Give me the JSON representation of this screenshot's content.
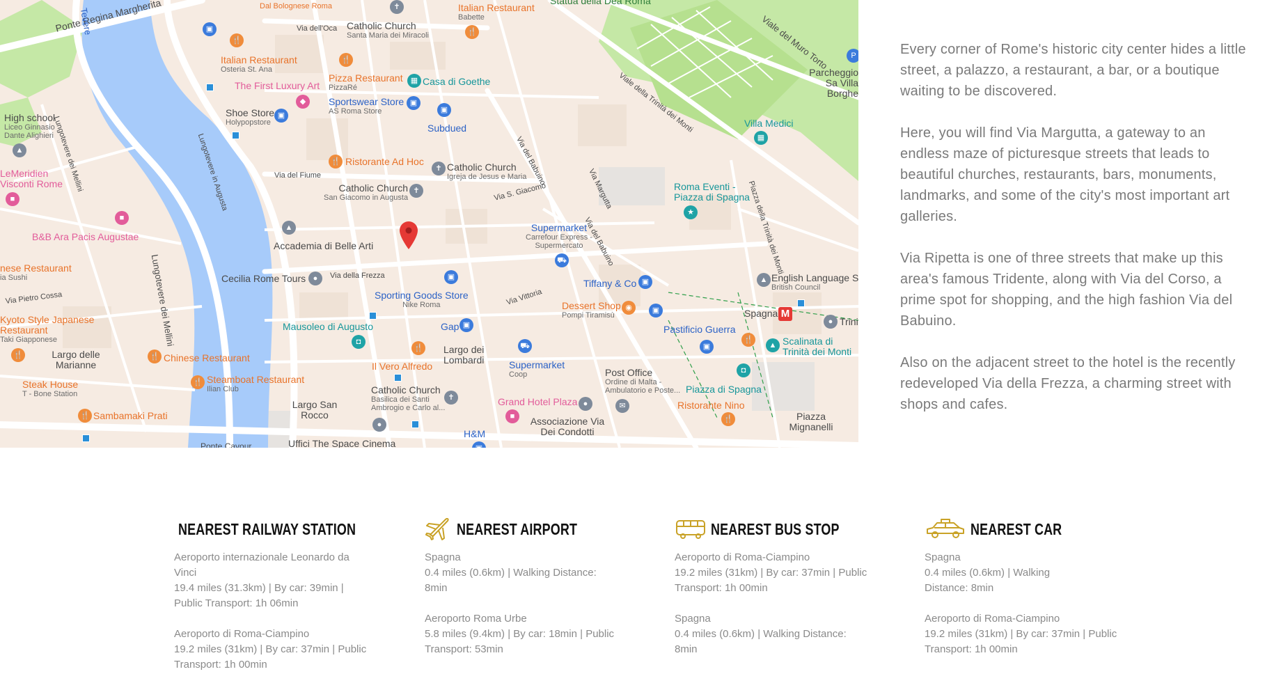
{
  "map": {
    "accent_colors": {
      "water": "#a7cbfa",
      "park": "#c5e8a6",
      "land": "#f6ebe2",
      "street": "#ffffff",
      "marker": "#e53935"
    },
    "streets": [
      "Ponte Regina Margherita",
      "Via dell'Oca",
      "Lungotevere dei Mellini",
      "Lungotevere in Augusta",
      "Lungotevere dei Mellini",
      "Via del Fiume",
      "Via S. Giacomo",
      "Via della Frezza",
      "Via Pietro Cossa",
      "Via del Babuino",
      "Via Margutta",
      "Via del Babuino",
      "Via Vittoria",
      "Viale della Trinità dei Monti",
      "Viale del Muro Torto",
      "Piazza della Trinità dei Monti",
      "Ponte Cavour",
      "Tevere"
    ],
    "pois": [
      {
        "name": "Dal Bolognese Roma",
        "sub": ""
      },
      {
        "name": "Catholic Church",
        "sub": "Santa Maria dei Miracoli"
      },
      {
        "name": "Italian Restaurant",
        "sub": "Babette"
      },
      {
        "name": "Statua della Dea Roma",
        "sub": ""
      },
      {
        "name": "Italian Restaurant",
        "sub": "Osteria St. Ana"
      },
      {
        "name": "Pizza Restaurant",
        "sub": "PizzaRé"
      },
      {
        "name": "Casa di Goethe",
        "sub": ""
      },
      {
        "name": "The First Luxury Art",
        "sub": ""
      },
      {
        "name": "Sportswear Store",
        "sub": "AS Roma Store"
      },
      {
        "name": "High school",
        "sub": "Liceo Ginnasio Dante Alighieri"
      },
      {
        "name": "Shoe Store",
        "sub": "Holypopstore"
      },
      {
        "name": "Subdued",
        "sub": ""
      },
      {
        "name": "Ristorante Ad Hoc",
        "sub": ""
      },
      {
        "name": "Catholic Church",
        "sub": "Igreja de Jesus e Maria"
      },
      {
        "name": "LeMeridien Visconti Rome",
        "sub": ""
      },
      {
        "name": "Catholic Church",
        "sub": "San Giacomo in Augusta"
      },
      {
        "name": "B&B Ara Pacis Augustae",
        "sub": ""
      },
      {
        "name": "Accademia di Belle Arti",
        "sub": ""
      },
      {
        "name": "Supermarket",
        "sub": "Carrefour Express - Supermercato"
      },
      {
        "name": "Roma Eventi - Piazza di Spagna",
        "sub": ""
      },
      {
        "name": "Parcheggio Sa Villa Borghe",
        "sub": ""
      },
      {
        "name": "Villa Medici",
        "sub": ""
      },
      {
        "name": "nese Restaurant",
        "sub": "ia Sushi"
      },
      {
        "name": "Cecilia Rome Tours",
        "sub": ""
      },
      {
        "name": "Sporting Goods Store",
        "sub": "Nike Roma"
      },
      {
        "name": "Tiffany & Co",
        "sub": ""
      },
      {
        "name": "English Language Sc",
        "sub": "British Council"
      },
      {
        "name": "Dessert Shop",
        "sub": "Pompi Tiramisù"
      },
      {
        "name": "Spagna",
        "sub": ""
      },
      {
        "name": "Kyoto Style Japanese Restaurant",
        "sub": "Taki Giapponese"
      },
      {
        "name": "Mausoleo di Augusto",
        "sub": ""
      },
      {
        "name": "Gap",
        "sub": ""
      },
      {
        "name": "Pastificio Guerra",
        "sub": ""
      },
      {
        "name": "Scalinata di Trinità dei Monti",
        "sub": ""
      },
      {
        "name": "Largo delle Marianne",
        "sub": ""
      },
      {
        "name": "Chinese Restaurant",
        "sub": ""
      },
      {
        "name": "Largo dei Lombardi",
        "sub": ""
      },
      {
        "name": "Supermarket",
        "sub": "Coop"
      },
      {
        "name": "Il Vero Alfredo",
        "sub": ""
      },
      {
        "name": "Post Office",
        "sub": "Ordine di Malta - Ambulatorio e Poste..."
      },
      {
        "name": "Steak House",
        "sub": "T - Bone Station"
      },
      {
        "name": "Steamboat Restaurant",
        "sub": "Ilian Club"
      },
      {
        "name": "Catholic Church",
        "sub": "Basilica dei Santi Ambrogio e Carlo al..."
      },
      {
        "name": "Piazza di Spagna",
        "sub": ""
      },
      {
        "name": "Ristorante Nino",
        "sub": ""
      },
      {
        "name": "Grand Hotel Plaza",
        "sub": ""
      },
      {
        "name": "Largo San Rocco",
        "sub": ""
      },
      {
        "name": "Sambamaki Prati",
        "sub": ""
      },
      {
        "name": "Associazione Via Dei Condotti",
        "sub": ""
      },
      {
        "name": "Piazza Mignanelli",
        "sub": ""
      },
      {
        "name": "H&M",
        "sub": ""
      },
      {
        "name": "Uffici The Space Cinema",
        "sub": ""
      },
      {
        "name": "Trini",
        "sub": ""
      }
    ]
  },
  "intro": {
    "paragraphs": [
      "Every corner of Rome's historic city center hides a little street, a palazzo, a restaurant, a bar, or a boutique waiting to be discovered.",
      "Here, you will find Via Margutta, a gateway to an endless maze of picturesque streets that leads to beautiful churches, restaurants, bars, monuments, landmarks, and some of the city's most important art galleries.",
      "Via Ripetta is one of three streets that make up this area's famous Tridente, along with Via del Corso, a prime spot for shopping, and the high fashion Via del Babuino.",
      "Also on the adjacent street to the hotel is the recently redeveloped Via della Frezza, a charming street with shops and cafes."
    ]
  },
  "nearest": {
    "accent_color": "#c9a227",
    "cards": [
      {
        "icon": "train-icon",
        "title": "Nearest Railway Station",
        "entries": [
          {
            "name": "Aeroporto internazionale Leonardo da Vinci",
            "details": "19.4 miles (31.3km) | By car: 39min | Public Transport: 1h 06min"
          },
          {
            "name": "Aeroporto di Roma-Ciampino",
            "details": "19.2 miles (31km) | By car: 37min | Public Transport: 1h 00min"
          }
        ]
      },
      {
        "icon": "airplane-icon",
        "title": "Nearest Airport",
        "entries": [
          {
            "name": "Spagna",
            "details": "0.4 miles (0.6km) | Walking Distance: 8min"
          },
          {
            "name": "Aeroporto Roma Urbe",
            "details": "5.8 miles (9.4km) | By car: 18min | Public Transport: 53min"
          }
        ]
      },
      {
        "icon": "bus-icon",
        "title": "Nearest Bus Stop",
        "entries": [
          {
            "name": "Aeroporto di Roma-Ciampino",
            "details": "19.2 miles (31km) | By car: 37min | Public Transport: 1h 00min"
          },
          {
            "name": "Spagna",
            "details": "0.4 miles (0.6km) | Walking Distance: 8min"
          }
        ]
      },
      {
        "icon": "taxi-icon",
        "title": "Nearest Car",
        "entries": [
          {
            "name": "Spagna",
            "details": "0.4 miles (0.6km) | Walking Distance: 8min"
          },
          {
            "name": "Aeroporto di Roma-Ciampino",
            "details": "19.2 miles (31km) | By car: 37min | Public Transport: 1h 00min"
          }
        ]
      }
    ]
  }
}
